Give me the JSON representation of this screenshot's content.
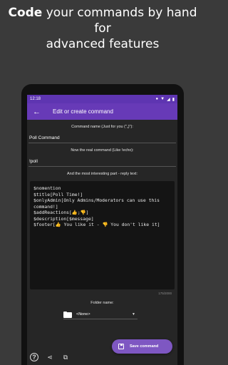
{
  "headline": {
    "bold": "Code",
    "rest_line1": " your commands by hand for",
    "line2": "advanced features"
  },
  "statusbar": {
    "time": "12:18",
    "icons": [
      "settings-dot-icon",
      "wifi-icon",
      "signal-icon",
      "battery-icon"
    ]
  },
  "appbar": {
    "back_icon": "←",
    "title": "Edit or create command"
  },
  "form": {
    "name_label": "Command name (Just for you (\"„)\"):",
    "name_value": "Poll Command",
    "real_label": "Now the real command (Like !echo):",
    "real_value": "!poll",
    "reply_label": "And the most interesting part - reply text:",
    "reply_text": "$nomention\n$title[Poll Time!]\n$onlyAdmin[Only Admins/Moderators can use this command!]\n$addReactions[👍;👎]\n$description[$message]\n$footer[👍 You like it - 👎 You don't like it]",
    "counter": "175/2000",
    "folder_label": "Folder name:",
    "folder_value": "<None>"
  },
  "fab": {
    "label": "Save command"
  },
  "bottombar": {
    "help": "?",
    "share": "⋖",
    "copy": "⧉"
  }
}
